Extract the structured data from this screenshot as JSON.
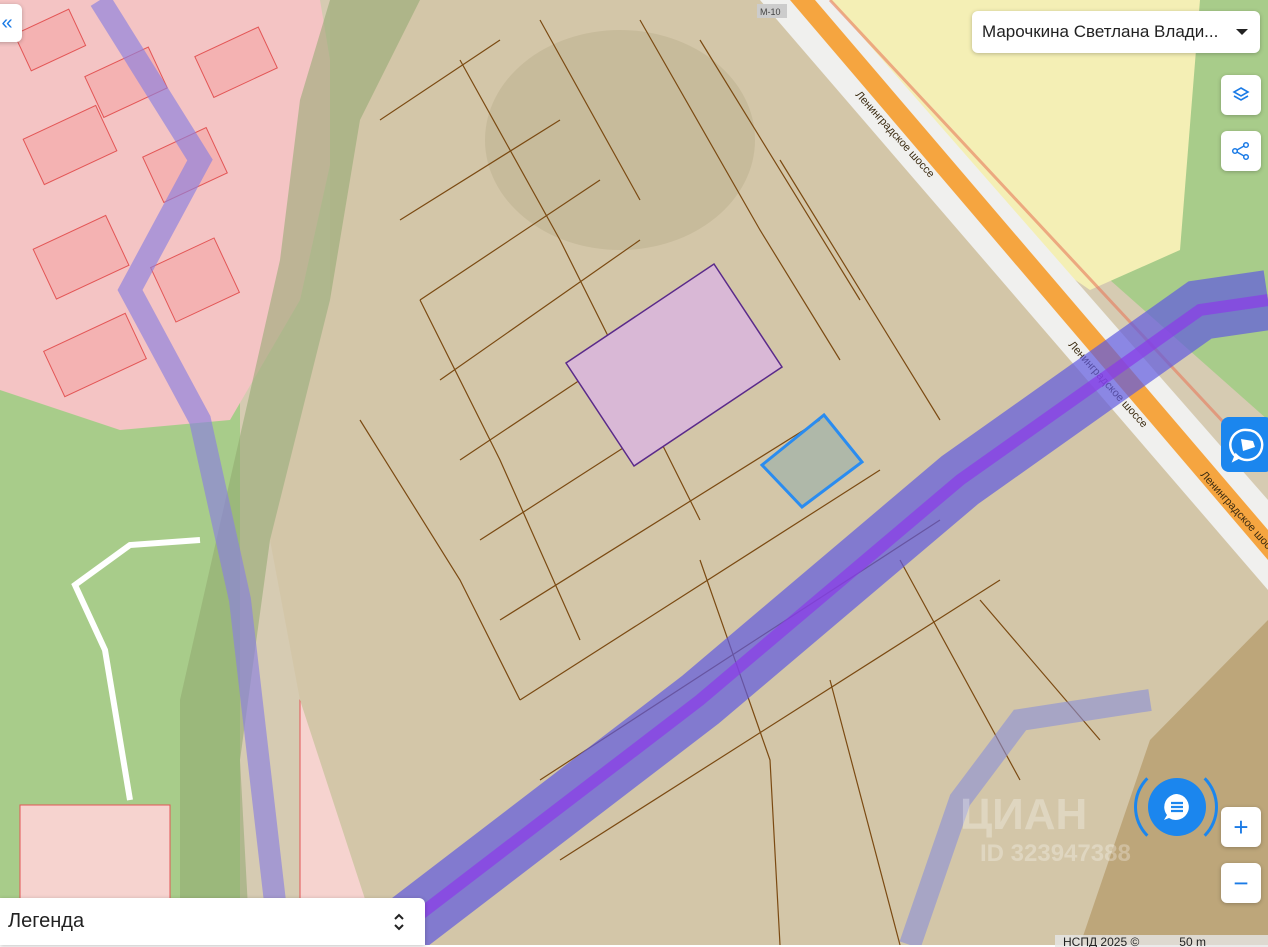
{
  "owner_select": {
    "value": "Марочкина Светлана Влади..."
  },
  "map": {
    "road_labels": [
      "Ленинградское шоссе",
      "Ленинградское шоссе",
      "Ленинградское шоссе"
    ],
    "route_badge": "М-10",
    "watermark_brand": "ЦИАН",
    "watermark_id": "ID 323947388"
  },
  "controls": {
    "zoom_in": "+",
    "zoom_out": "−",
    "back": "«"
  },
  "legend": {
    "label": "Легенда"
  },
  "attribution": {
    "text": "НСПД 2025 ©",
    "scale": "50 m"
  },
  "colors": {
    "accent": "#1b86ee",
    "selected_parcel": "#2a8cf0",
    "highlight_parcel": "#d9b8d6"
  }
}
